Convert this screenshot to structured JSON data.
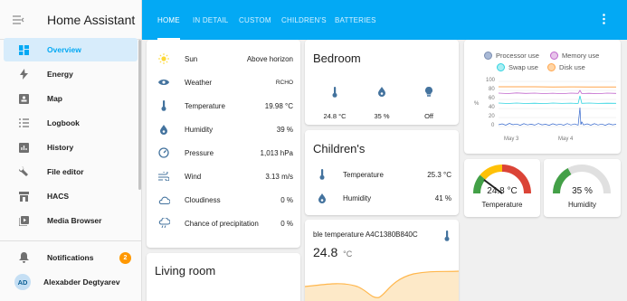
{
  "app": {
    "title": "Home Assistant",
    "menu_icon": "hamburger-icon"
  },
  "sidebar": {
    "items": [
      {
        "label": "Overview",
        "icon": "dashboard-icon",
        "active": true
      },
      {
        "label": "Energy",
        "icon": "lightning-icon"
      },
      {
        "label": "Map",
        "icon": "map-icon"
      },
      {
        "label": "Logbook",
        "icon": "list-icon"
      },
      {
        "label": "History",
        "icon": "chart-bar-icon"
      },
      {
        "label": "File editor",
        "icon": "wrench-icon"
      },
      {
        "label": "HACS",
        "icon": "hacs-icon"
      },
      {
        "label": "Media Browser",
        "icon": "play-box-icon"
      }
    ],
    "notifications": {
      "label": "Notifications",
      "count": "2"
    },
    "user": {
      "initials": "AD",
      "name": "Alexabder Degtyarev"
    }
  },
  "tabs": [
    "HOME",
    "IN DETAIL",
    "CUSTOM",
    "CHILDREN'S",
    "BATTERIES"
  ],
  "weather_card": {
    "rows": [
      {
        "label": "Sun",
        "value": "Above horizon"
      },
      {
        "label": "Weather",
        "value": "RCHO"
      },
      {
        "label": "Temperature",
        "value": "19.98 °C"
      },
      {
        "label": "Humidity",
        "value": "39 %"
      },
      {
        "label": "Pressure",
        "value": "1,013 hPa"
      },
      {
        "label": "Wind",
        "value": "3.13 m/s"
      },
      {
        "label": "Cloudiness",
        "value": "0 %"
      },
      {
        "label": "Chance of precipitation",
        "value": "0 %"
      }
    ]
  },
  "living_room": {
    "title": "Living room"
  },
  "bedroom": {
    "title": "Bedroom",
    "glances": [
      {
        "icon": "thermometer-icon",
        "value": "24.8 °C"
      },
      {
        "icon": "water-drop-icon",
        "value": "35 %"
      },
      {
        "icon": "lightbulb-icon",
        "value": "Off"
      }
    ]
  },
  "childrens": {
    "title": "Children's",
    "rows": [
      {
        "label": "Temperature",
        "value": "25.3 °C"
      },
      {
        "label": "Humidity",
        "value": "41 %"
      }
    ]
  },
  "sensor_card": {
    "name": "ble temperature A4C1380B840C",
    "value": "24.8",
    "unit": "°C"
  },
  "gauges": [
    {
      "value": "24.8 °C",
      "label": "Temperature",
      "fraction": 0.62
    },
    {
      "value": "35 %",
      "label": "Humidity",
      "fraction": 0.35
    }
  ],
  "colors": {
    "primary": "#03a9f4",
    "icon": "#44739e",
    "processor": "#3366cc",
    "memory": "#c066cc",
    "swap": "#2fd3e0",
    "disk": "#ffa64d",
    "gauge_green": "#43a047",
    "gauge_yellow": "#ffc107",
    "gauge_red": "#db4437"
  },
  "chart_data": {
    "type": "line",
    "legend": [
      "Processor use",
      "Memory use",
      "Swap use",
      "Disk use"
    ],
    "y_ticks": [
      "100",
      "80",
      "60",
      "40",
      "20",
      "0"
    ],
    "ylabel": "%",
    "x_ticks": [
      "May 3",
      "May 4"
    ],
    "ylim": [
      0,
      100
    ],
    "series": [
      {
        "name": "Processor use",
        "approx_level": 3
      },
      {
        "name": "Memory use",
        "approx_level": 74
      },
      {
        "name": "Swap use",
        "approx_level": 45
      },
      {
        "name": "Disk use",
        "approx_level": 88
      }
    ]
  }
}
